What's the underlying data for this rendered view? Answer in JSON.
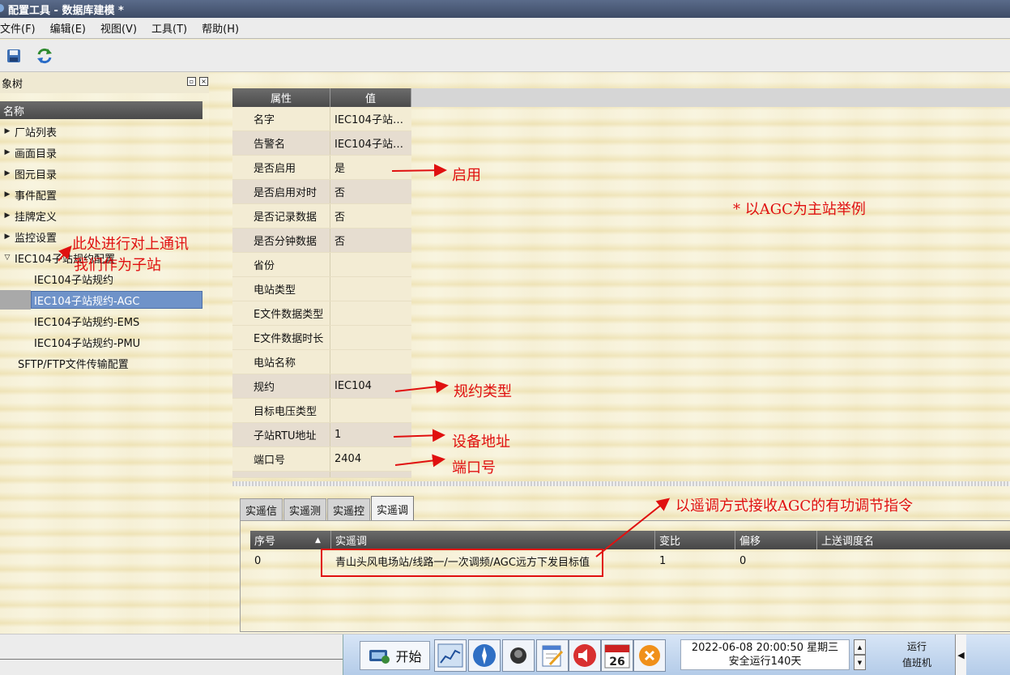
{
  "window": {
    "title": "配置工具 - 数据库建模 *"
  },
  "menu": [
    "文件(F)",
    "编辑(E)",
    "视图(V)",
    "工具(T)",
    "帮助(H)"
  ],
  "toolbar": {
    "buttons": [
      "save-icon",
      "refresh-icon"
    ]
  },
  "tree": {
    "panel_title": "象树",
    "column_header": "名称",
    "items": [
      {
        "label": "厂站列表",
        "arrow": "▶"
      },
      {
        "label": "画面目录",
        "arrow": "▶"
      },
      {
        "label": "图元目录",
        "arrow": "▶"
      },
      {
        "label": "事件配置",
        "arrow": "▶"
      },
      {
        "label": "挂牌定义",
        "arrow": "▶"
      },
      {
        "label": "监控设置",
        "arrow": "▶"
      },
      {
        "label": "IEC104子站规约配置",
        "arrow": "▽"
      },
      {
        "label": "IEC104子站规约"
      },
      {
        "label": "IEC104子站规约-AGC",
        "selected": true
      },
      {
        "label": "IEC104子站规约-EMS"
      },
      {
        "label": "IEC104子站规约-PMU"
      },
      {
        "label": "SFTP/FTP文件传输配置"
      }
    ]
  },
  "properties": {
    "header_key": "属性",
    "header_value": "值",
    "rows": [
      {
        "key": "名字",
        "value": "IEC104子站…"
      },
      {
        "key": "告警名",
        "value": "IEC104子站…"
      },
      {
        "key": "是否启用",
        "value": "是"
      },
      {
        "key": "是否启用对时",
        "value": "否"
      },
      {
        "key": "是否记录数据",
        "value": "否"
      },
      {
        "key": "是否分钟数据",
        "value": "否"
      },
      {
        "key": "省份",
        "value": ""
      },
      {
        "key": "电站类型",
        "value": ""
      },
      {
        "key": "E文件数据类型",
        "value": ""
      },
      {
        "key": "E文件数据时长",
        "value": ""
      },
      {
        "key": "电站名称",
        "value": ""
      },
      {
        "key": "规约",
        "value": "IEC104"
      },
      {
        "key": "目标电压类型",
        "value": ""
      },
      {
        "key": "子站RTU地址",
        "value": "1"
      },
      {
        "key": "端口号",
        "value": "2404"
      }
    ]
  },
  "bottom": {
    "tabs": [
      {
        "label": "实遥信",
        "active": false
      },
      {
        "label": "实遥测",
        "active": false
      },
      {
        "label": "实遥控",
        "active": false
      },
      {
        "label": "实遥调",
        "active": true
      }
    ],
    "columns": [
      "序号",
      "实遥调",
      "变比",
      "偏移",
      "上送调度名"
    ],
    "sort_indicator": "▲",
    "rows": [
      {
        "index": "0",
        "name": "青山头风电场站/线路一/一次调频/AGC远方下发目标值",
        "ratio": "1",
        "offset": "0",
        "dispatch_name": ""
      }
    ]
  },
  "annotations": {
    "enable": "启用",
    "main_station": "* 以AGC为主站举例",
    "uplink_1": "此处进行对上通讯",
    "uplink_2": "我们作为子站",
    "protocol_type": "规约类型",
    "device_address": "设备地址",
    "port": "端口号",
    "agc_receive": "以遥调方式接收AGC的有功调节指令"
  },
  "taskbar": {
    "start_label": "开始",
    "quick_icons": [
      "chart-icon",
      "compass-icon",
      "record-icon",
      "notepad-icon",
      "speaker-icon",
      "calendar-icon",
      "close-icon"
    ],
    "calendar_day": "26",
    "datetime": "2022-06-08 20:00:50 星期三",
    "uptime": "安全运行140天",
    "status": "运行",
    "role": "值班机"
  },
  "colors": {
    "annotation": "#e01010",
    "selection": "#6f93c9",
    "header_dark": "#4a4a4a"
  }
}
